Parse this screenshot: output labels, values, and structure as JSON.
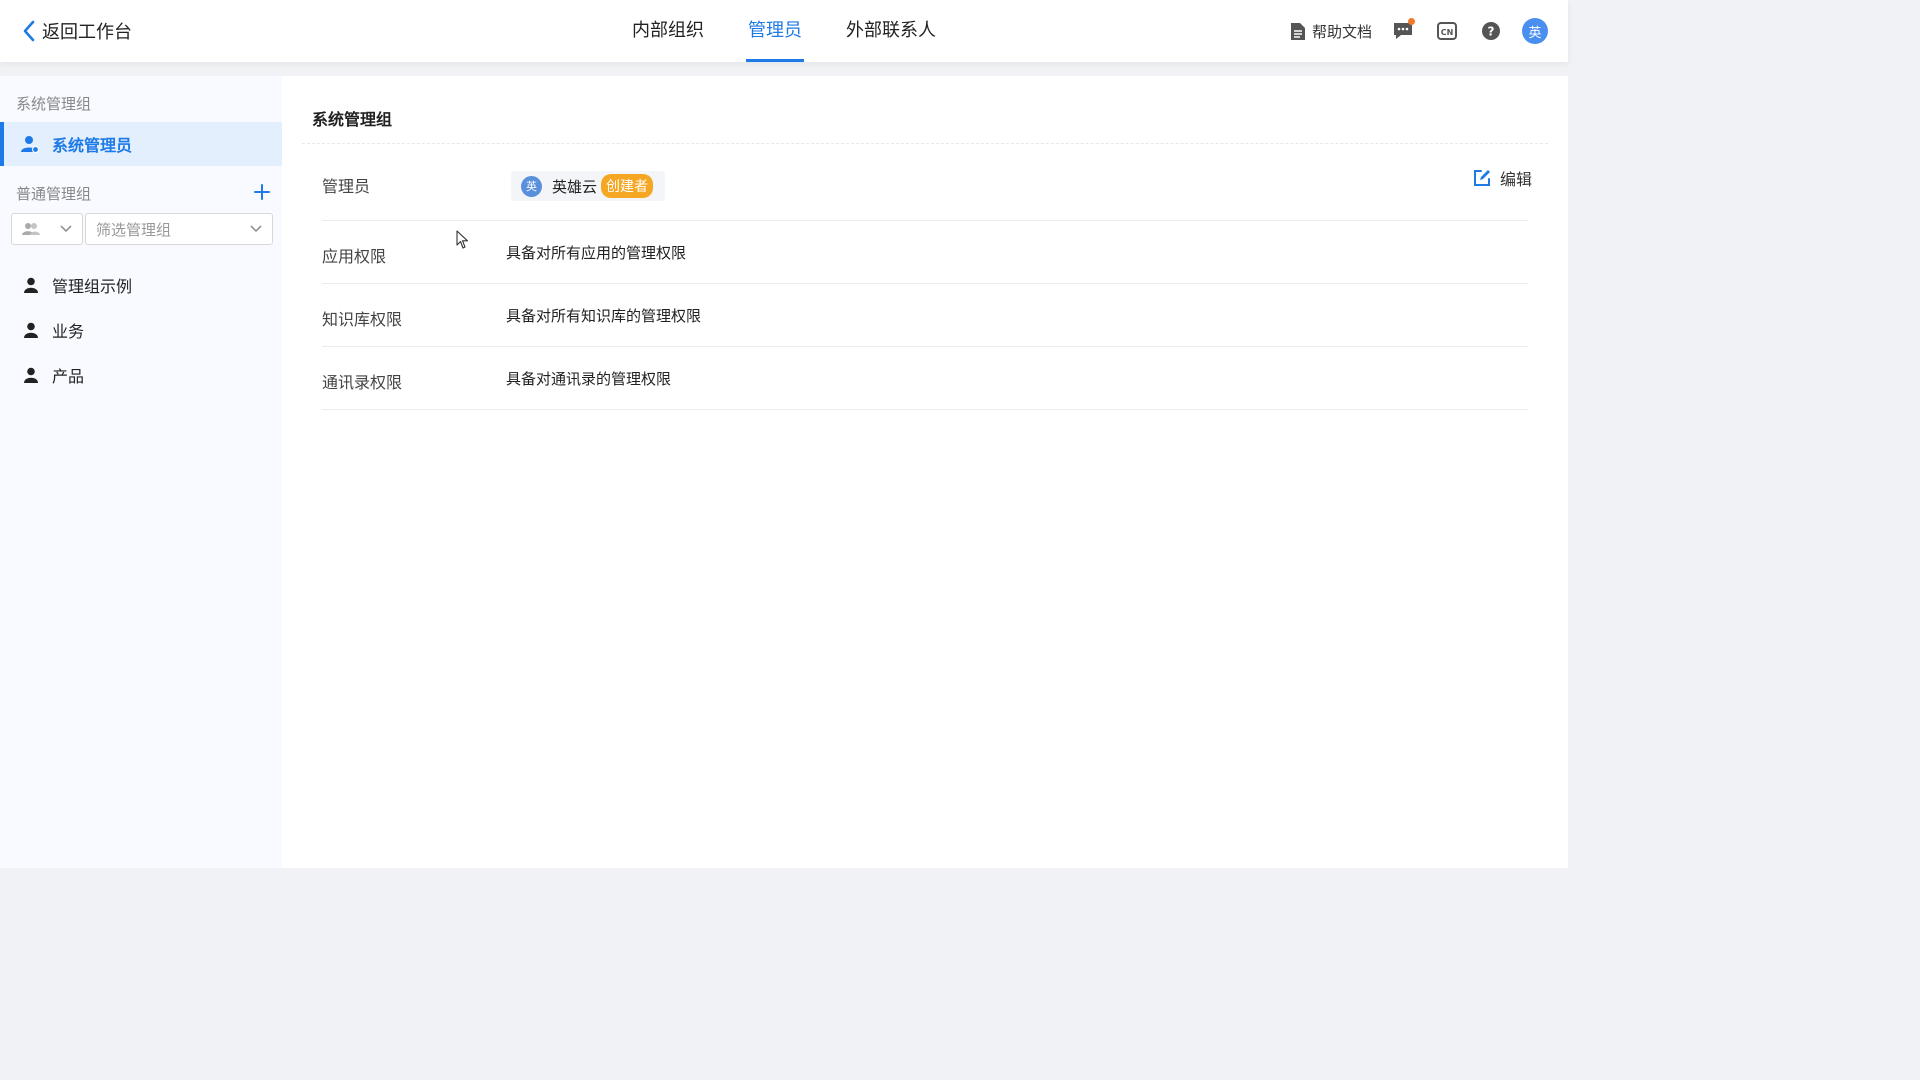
{
  "header": {
    "back_label": "返回工作台",
    "tabs": [
      {
        "label": "内部组织",
        "active": false
      },
      {
        "label": "管理员",
        "active": true
      },
      {
        "label": "外部联系人",
        "active": false
      }
    ],
    "help_doc_label": "帮助文档",
    "avatar_text": "英",
    "accent_color": "#1e7ae6",
    "notification_dot_color": "#f07a2a"
  },
  "sidebar": {
    "system_group_title": "系统管理组",
    "system_admin_label": "系统管理员",
    "normal_group_title": "普通管理组",
    "filter_placeholder": "筛选管理组",
    "groups": [
      {
        "label": "管理组示例"
      },
      {
        "label": "业务"
      },
      {
        "label": "产品"
      }
    ]
  },
  "content": {
    "title": "系统管理组",
    "edit_label": "编辑",
    "admin_row": {
      "label": "管理员",
      "avatar_text": "英",
      "name": "英雄云",
      "tag": "创建者"
    },
    "permissions": [
      {
        "label": "应用权限",
        "value": "具备对所有应用的管理权限"
      },
      {
        "label": "知识库权限",
        "value": "具备对所有知识库的管理权限"
      },
      {
        "label": "通讯录权限",
        "value": "具备对通讯录的管理权限"
      }
    ]
  }
}
